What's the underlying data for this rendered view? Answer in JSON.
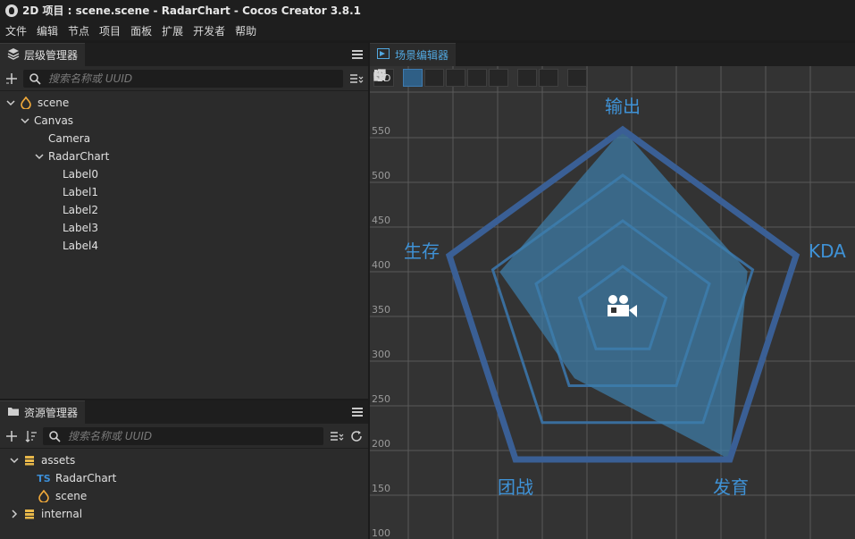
{
  "window": {
    "title": "2D 项目 : scene.scene - RadarChart - Cocos Creator 3.8.1"
  },
  "menu": [
    "文件",
    "编辑",
    "节点",
    "项目",
    "面板",
    "扩展",
    "开发者",
    "帮助"
  ],
  "hierarchy": {
    "tab_label": "层级管理器",
    "search_placeholder": "搜索名称或 UUID",
    "nodes": [
      {
        "label": "scene",
        "depth": 0,
        "expanded": true,
        "icon": "cocos-scene-icon"
      },
      {
        "label": "Canvas",
        "depth": 1,
        "expanded": true,
        "icon": ""
      },
      {
        "label": "Camera",
        "depth": 2,
        "expanded": null,
        "icon": ""
      },
      {
        "label": "RadarChart",
        "depth": 2,
        "expanded": true,
        "icon": ""
      },
      {
        "label": "Label0",
        "depth": 3,
        "expanded": null,
        "icon": ""
      },
      {
        "label": "Label1",
        "depth": 3,
        "expanded": null,
        "icon": ""
      },
      {
        "label": "Label2",
        "depth": 3,
        "expanded": null,
        "icon": ""
      },
      {
        "label": "Label3",
        "depth": 3,
        "expanded": null,
        "icon": ""
      },
      {
        "label": "Label4",
        "depth": 3,
        "expanded": null,
        "icon": ""
      }
    ]
  },
  "assets": {
    "tab_label": "资源管理器",
    "search_placeholder": "搜索名称或 UUID",
    "items": [
      {
        "label": "assets",
        "depth": 0,
        "expanded": true,
        "icon": "folder-db-icon"
      },
      {
        "label": "RadarChart",
        "depth": 1,
        "expanded": null,
        "icon": "ts-icon"
      },
      {
        "label": "scene",
        "depth": 1,
        "expanded": null,
        "icon": "cocos-scene-icon"
      },
      {
        "label": "internal",
        "depth": 0,
        "expanded": false,
        "icon": "folder-db-icon"
      }
    ]
  },
  "scene_editor": {
    "tab_label": "场景编辑器",
    "mode_2d": "2D",
    "y_ruler": [
      "550",
      "500",
      "450",
      "400",
      "350",
      "300",
      "250",
      "200",
      "150",
      "100"
    ],
    "radar": {
      "labels": [
        "输出",
        "KDA",
        "发育",
        "团战",
        "生存"
      ],
      "data_fractions": [
        1.0,
        0.72,
        1.0,
        0.45,
        0.71
      ],
      "rings": [
        0.25,
        0.5,
        0.75
      ]
    },
    "colors": {
      "background": "#333333",
      "grid": "#5a5a5a",
      "outer_border": "#3a5f95",
      "fill": "#3d7fad",
      "inner_rings": "#3a6e9d",
      "label": "#3f92d6"
    }
  }
}
